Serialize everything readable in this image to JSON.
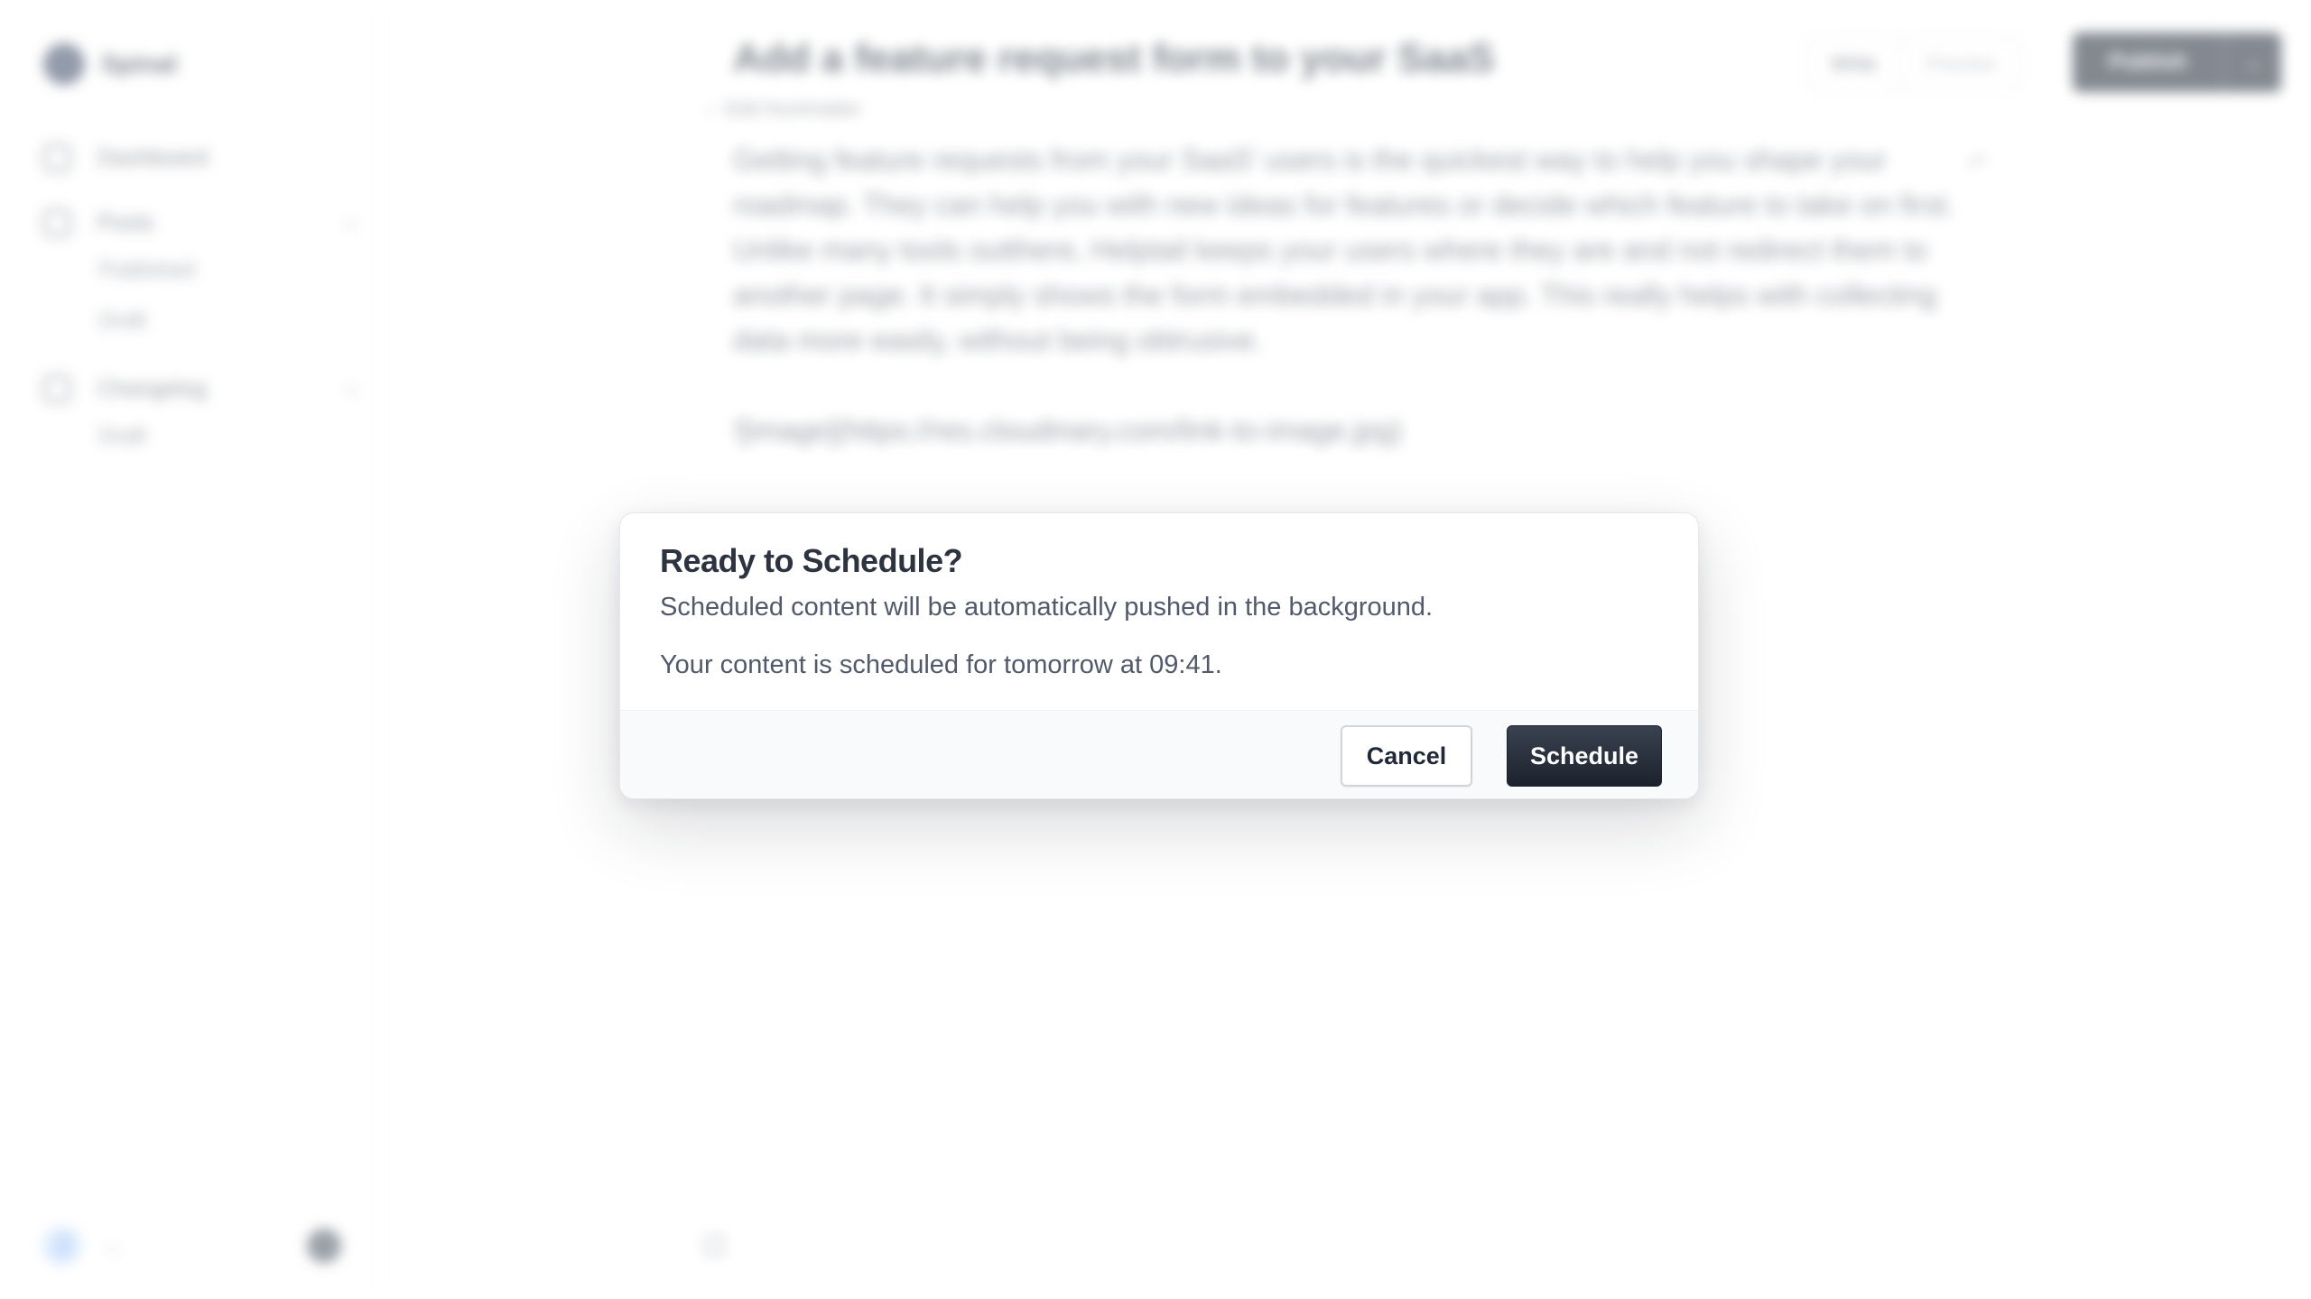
{
  "sidebar": {
    "brand": {
      "name": "Spinal",
      "logo_icon": "brand-logo-icon"
    },
    "nav": {
      "dashboard": {
        "label": "Dashboard",
        "icon": "home-icon"
      },
      "posts": {
        "label": "Posts",
        "icon": "document-icon",
        "children": [
          {
            "label": "Published"
          },
          {
            "label": "Draft"
          }
        ]
      },
      "changelog": {
        "label": "Changelog",
        "icon": "changelog-icon",
        "children": [
          {
            "label": "Draft"
          }
        ]
      }
    },
    "footer": {
      "avatar_initial": "J"
    }
  },
  "editor": {
    "title": "Add a feature request form to your SaaS",
    "frontmatter_label": "Edit frontmatter",
    "paragraphs": [
      "Getting feature requests from your SaaS' users is the quickest way to help you shape your roadmap. They can help you with new ideas for features or decide which feature to take on first. Unlike many tools outthere, Helptail keeps your users where they are and not redirect them to another page. It simply shows the form embedded in your app. This really helps with collecting data more easily, without being obtrusive.",
      "![image](https://res.cloudinary.com/link-to-image.jpg)"
    ]
  },
  "header": {
    "tabs": [
      {
        "label": "Write"
      },
      {
        "label": "Preview"
      }
    ],
    "publish_label": "Publish"
  },
  "modal": {
    "title": "Ready to Schedule?",
    "description": "Scheduled content will be automatically pushed in the background.",
    "info": "Your content is scheduled for tomorrow at 09:41.",
    "cancel_label": "Cancel",
    "confirm_label": "Schedule"
  },
  "colors": {
    "primary_button": "#1f2937",
    "title_text": "#2d3440",
    "body_text": "#52596a",
    "footer_bg": "#f9fafb"
  }
}
